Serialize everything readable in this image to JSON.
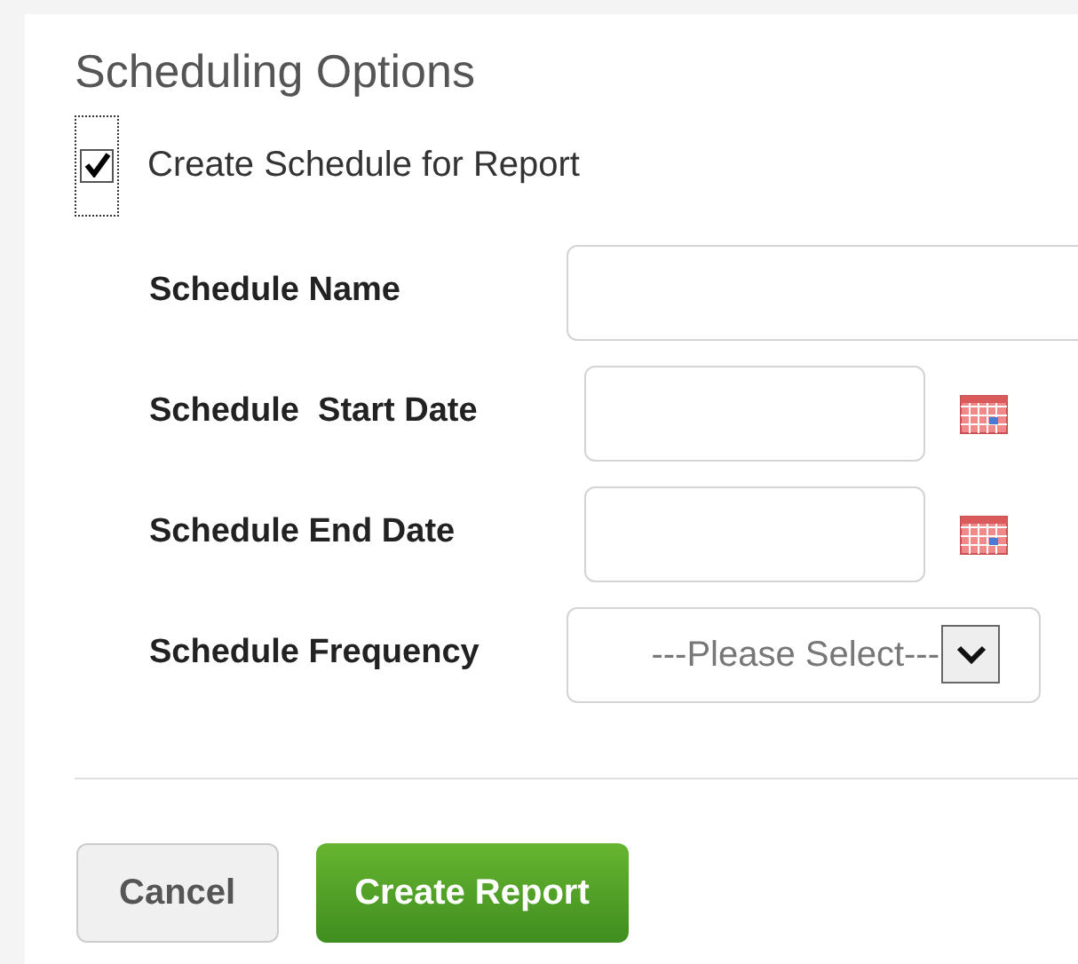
{
  "section": {
    "title": "Scheduling Options"
  },
  "schedule_checkbox": {
    "label": "Create Schedule for Report",
    "checked": true
  },
  "fields": [
    {
      "kind": "text",
      "label": "Schedule Name"
    },
    {
      "kind": "date",
      "label": "Schedule  Start Date"
    },
    {
      "kind": "date",
      "label": "Schedule End Date"
    },
    {
      "kind": "select",
      "label": "Schedule Frequency",
      "value": "---Please Select---"
    }
  ],
  "buttons": [
    {
      "kind": "secondary",
      "label": "Cancel"
    },
    {
      "kind": "primary",
      "label": "Create Report"
    }
  ]
}
